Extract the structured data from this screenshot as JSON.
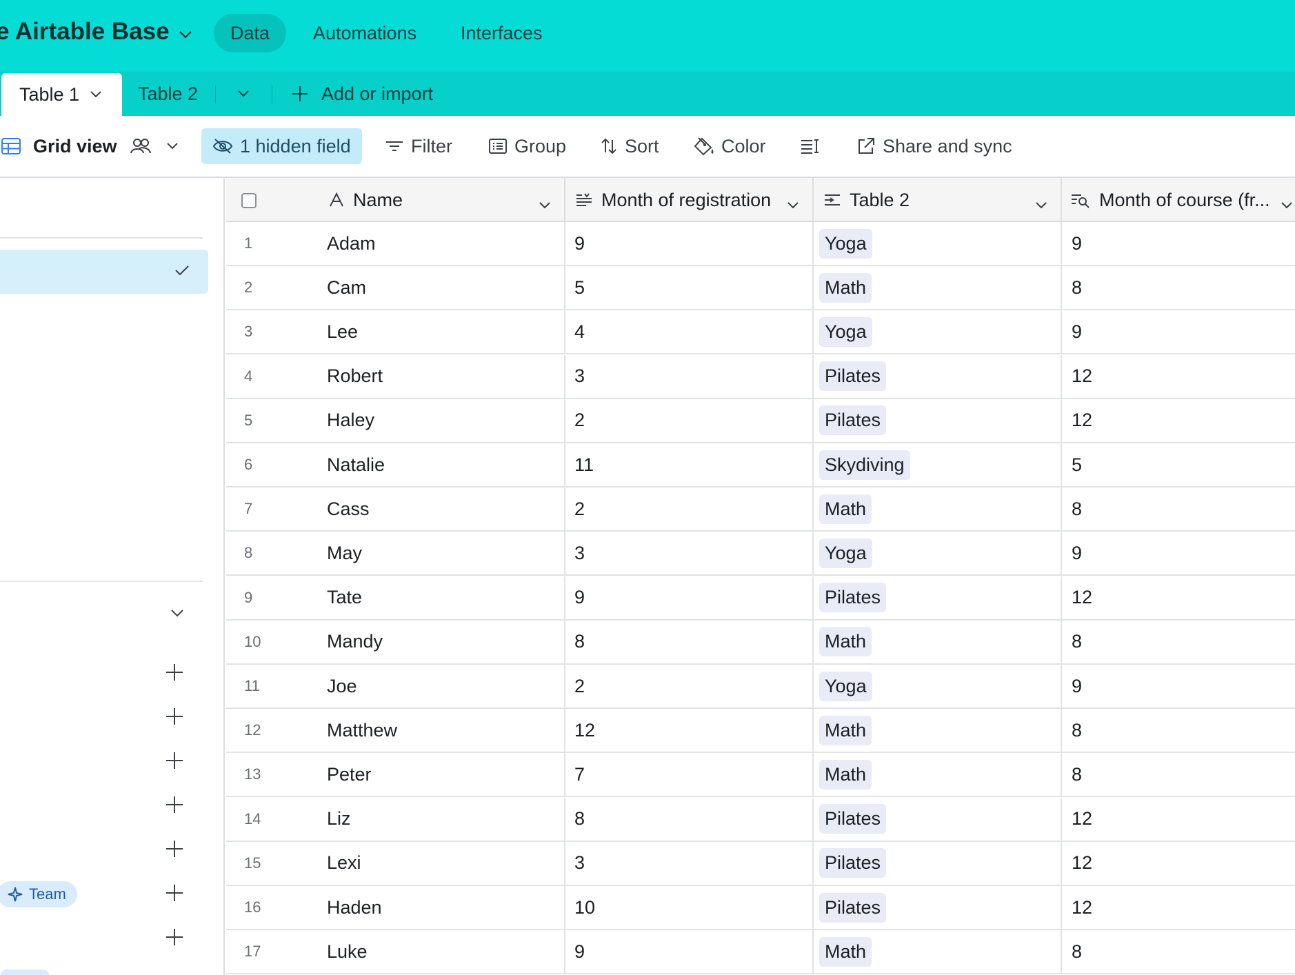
{
  "app": {
    "base_title": "e Airtable Base",
    "nav": {
      "data": "Data",
      "automations": "Automations",
      "interfaces": "Interfaces"
    },
    "accent_color": "#05dcd6"
  },
  "tabs": {
    "table1": "Table 1",
    "table2": "Table 2",
    "add_or_import": "Add or import"
  },
  "viewbar": {
    "view_name": "Grid view",
    "hidden_field": "1 hidden field",
    "filter": "Filter",
    "group": "Group",
    "sort": "Sort",
    "color": "Color",
    "share": "Share and sync"
  },
  "sidebar": {
    "team_badge": "Team"
  },
  "grid": {
    "columns": {
      "name": "Name",
      "month_registration": "Month of registration",
      "table2": "Table 2",
      "month_course": "Month of course (fr..."
    },
    "rows": [
      {
        "num": "1",
        "name": "Adam",
        "month": "9",
        "course": "Yoga",
        "course_month": "9"
      },
      {
        "num": "2",
        "name": "Cam",
        "month": "5",
        "course": "Math",
        "course_month": "8"
      },
      {
        "num": "3",
        "name": "Lee",
        "month": "4",
        "course": "Yoga",
        "course_month": "9"
      },
      {
        "num": "4",
        "name": "Robert",
        "month": "3",
        "course": "Pilates",
        "course_month": "12"
      },
      {
        "num": "5",
        "name": "Haley",
        "month": "2",
        "course": "Pilates",
        "course_month": "12"
      },
      {
        "num": "6",
        "name": "Natalie",
        "month": "11",
        "course": "Skydiving",
        "course_month": "5"
      },
      {
        "num": "7",
        "name": "Cass",
        "month": "2",
        "course": "Math",
        "course_month": "8"
      },
      {
        "num": "8",
        "name": "May",
        "month": "3",
        "course": "Yoga",
        "course_month": "9"
      },
      {
        "num": "9",
        "name": "Tate",
        "month": "9",
        "course": "Pilates",
        "course_month": "12"
      },
      {
        "num": "10",
        "name": "Mandy",
        "month": "8",
        "course": "Math",
        "course_month": "8"
      },
      {
        "num": "11",
        "name": "Joe",
        "month": "2",
        "course": "Yoga",
        "course_month": "9"
      },
      {
        "num": "12",
        "name": "Matthew",
        "month": "12",
        "course": "Math",
        "course_month": "8"
      },
      {
        "num": "13",
        "name": "Peter",
        "month": "7",
        "course": "Math",
        "course_month": "8"
      },
      {
        "num": "14",
        "name": "Liz",
        "month": "8",
        "course": "Pilates",
        "course_month": "12"
      },
      {
        "num": "15",
        "name": "Lexi",
        "month": "3",
        "course": "Pilates",
        "course_month": "12"
      },
      {
        "num": "16",
        "name": "Haden",
        "month": "10",
        "course": "Pilates",
        "course_month": "12"
      },
      {
        "num": "17",
        "name": "Luke",
        "month": "9",
        "course": "Math",
        "course_month": "8"
      }
    ]
  }
}
